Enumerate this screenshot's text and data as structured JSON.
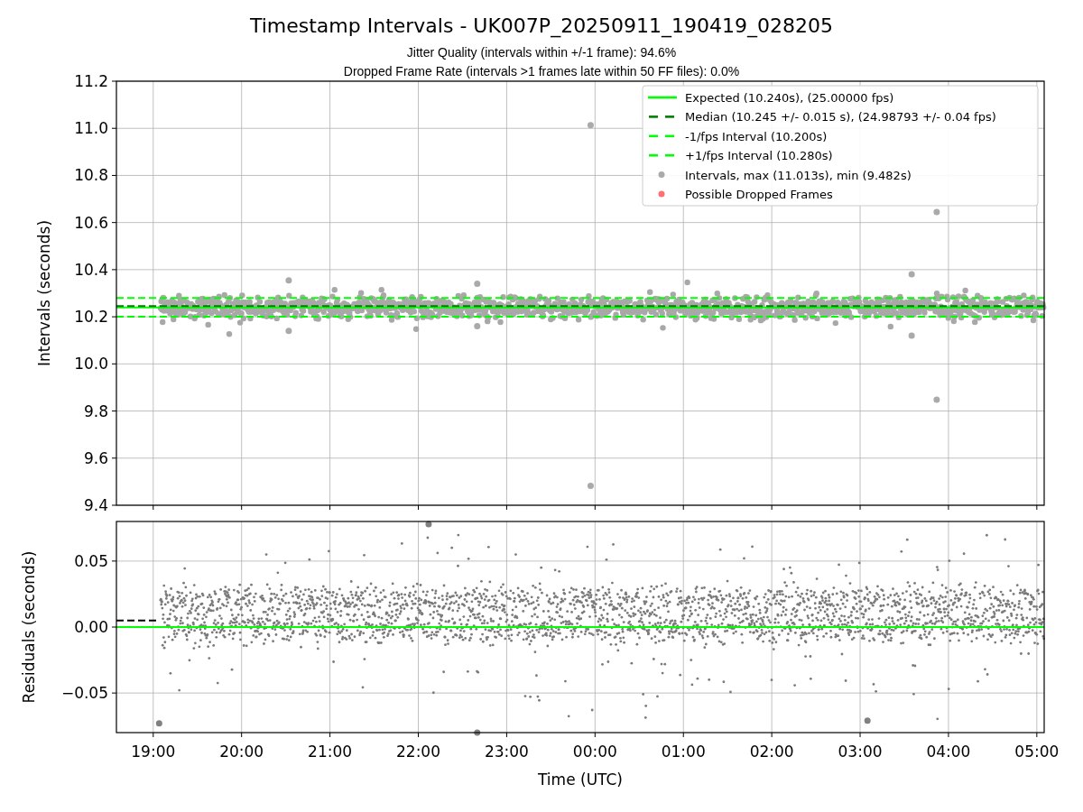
{
  "figure": {
    "title": "Timestamp Intervals - UK007P_20250911_190419_028205",
    "subtitle_lines": [
      "Jitter Quality (intervals within +/-1 frame): 94.6%",
      "Dropped Frame Rate (intervals >1 frames late within 50 FF files): 0.0%"
    ]
  },
  "intervals_plot": {
    "legend": [
      {
        "label": "Expected (10.240s), (25.00000 fps)",
        "kind": "solid-line",
        "color": "#00ff00"
      },
      {
        "label": "Median (10.245 +/- 0.015 s), (24.98793 +/- 0.04 fps)",
        "kind": "dashed-line",
        "color": "#007f00"
      },
      {
        "label": "-1/fps Interval (10.200s)",
        "kind": "dashed-line",
        "color": "#00ff00"
      },
      {
        "label": "+1/fps Interval (10.280s)",
        "kind": "dashed-line",
        "color": "#00ff00"
      },
      {
        "label": "Intervals, max (11.013s), min (9.482s)",
        "kind": "marker",
        "color": "#aaaaaa"
      },
      {
        "label": "Possible Dropped Frames",
        "kind": "marker",
        "color": "#ff6f6f"
      }
    ],
    "chart_data": {
      "type": "scatter",
      "ylabel": "Intervals (seconds)",
      "x": [
        "2025-09-11T23:57",
        "2025-09-11T23:57",
        "2025-09-12T03:52",
        "2025-09-12T03:52",
        "2025-09-12T03:35",
        "2025-09-12T03:35",
        "2025-09-11T20:32",
        "2025-09-11T20:32",
        "2025-09-11T22:40",
        "2025-09-11T22:40"
      ],
      "series": [
        {
          "color": "#aaaaaa",
          "values": [
            11.013,
            9.482,
            10.645,
            9.848,
            10.38,
            10.12,
            10.355,
            10.14,
            10.34,
            10.16
          ]
        }
      ],
      "xlim": [
        "2025-09-11T18:35",
        "2025-09-12T05:05"
      ],
      "ylim": [
        9.4,
        11.2
      ],
      "yticks": [
        {
          "value": 9.4,
          "label": "9.4"
        },
        {
          "value": 9.6,
          "label": "9.6"
        },
        {
          "value": 9.8,
          "label": "9.8"
        },
        {
          "value": 10.0,
          "label": "10.0"
        },
        {
          "value": 10.2,
          "label": "10.2"
        },
        {
          "value": 10.4,
          "label": "10.4"
        },
        {
          "value": 10.6,
          "label": "10.6"
        },
        {
          "value": 10.8,
          "label": "10.8"
        },
        {
          "value": 11.0,
          "label": "11.0"
        },
        {
          "value": 11.2,
          "label": "11.2"
        }
      ],
      "grid": true,
      "ref_lines": [
        {
          "axis": "y",
          "value": 10.24
        },
        {
          "axis": "y",
          "value": 10.245
        },
        {
          "axis": "y",
          "value": 10.2
        },
        {
          "axis": "y",
          "value": 10.28
        }
      ]
    }
  },
  "residuals_plot": {
    "chart_data": {
      "type": "scatter",
      "xlabel": "Time (UTC)",
      "ylabel": "Residuals (seconds)",
      "x": [
        "2025-09-11T22:07",
        "2025-09-11T22:40",
        "2025-09-11T19:04",
        "2025-09-12T03:05"
      ],
      "series": [
        {
          "color": "#808080",
          "values": [
            0.078,
            -0.08,
            -0.073,
            -0.071
          ]
        }
      ],
      "xlim": [
        "2025-09-11T18:35",
        "2025-09-12T05:05"
      ],
      "ylim": [
        -0.08,
        0.08
      ],
      "xticks": [
        {
          "value": "2025-09-11T19:00",
          "label": "19:00"
        },
        {
          "value": "2025-09-11T20:00",
          "label": "20:00"
        },
        {
          "value": "2025-09-11T21:00",
          "label": "21:00"
        },
        {
          "value": "2025-09-11T22:00",
          "label": "22:00"
        },
        {
          "value": "2025-09-11T23:00",
          "label": "23:00"
        },
        {
          "value": "2025-09-12T00:00",
          "label": "00:00"
        },
        {
          "value": "2025-09-12T01:00",
          "label": "01:00"
        },
        {
          "value": "2025-09-12T02:00",
          "label": "02:00"
        },
        {
          "value": "2025-09-12T03:00",
          "label": "03:00"
        },
        {
          "value": "2025-09-12T04:00",
          "label": "04:00"
        },
        {
          "value": "2025-09-12T05:00",
          "label": "05:00"
        }
      ],
      "yticks": [
        {
          "value": -0.05,
          "label": "−0.05"
        },
        {
          "value": 0,
          "label": "0.00"
        },
        {
          "value": 0.05,
          "label": "0.05"
        }
      ],
      "grid": true,
      "ref_lines": [
        {
          "axis": "y",
          "value": 0
        }
      ]
    }
  }
}
